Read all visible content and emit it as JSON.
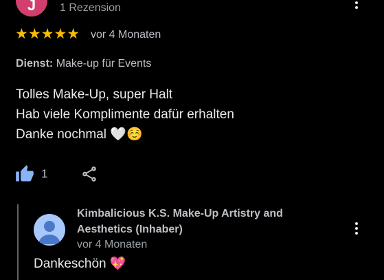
{
  "review": {
    "avatar_letter": "J",
    "reviewer_review_count": "1 Rezension",
    "stars": "★★★★★",
    "rating": 5,
    "age": "vor 4 Monaten",
    "service_label": "Dienst:",
    "service_value": "Make-up für Events",
    "text_lines": [
      "Tolles Make-Up, super Halt",
      "Hab viele Komplimente dafür erhalten",
      "Danke nochmal 🤍☺️"
    ],
    "like_count": "1"
  },
  "owner_reply": {
    "name": "Kimbalicious K.S. Make-Up Artistry and Aesthetics (Inhaber)",
    "age": "vor 4 Monaten",
    "text": "Dankeschön 💖"
  },
  "colors": {
    "background": "#000000",
    "star": "#fbbc04",
    "like_icon": "#8ab4f8",
    "avatar_reviewer": "#d23f6c",
    "avatar_owner": "#a8c7fa"
  },
  "icons": {
    "more": "more-vert-icon",
    "like": "thumb-up-icon",
    "share": "share-icon"
  }
}
